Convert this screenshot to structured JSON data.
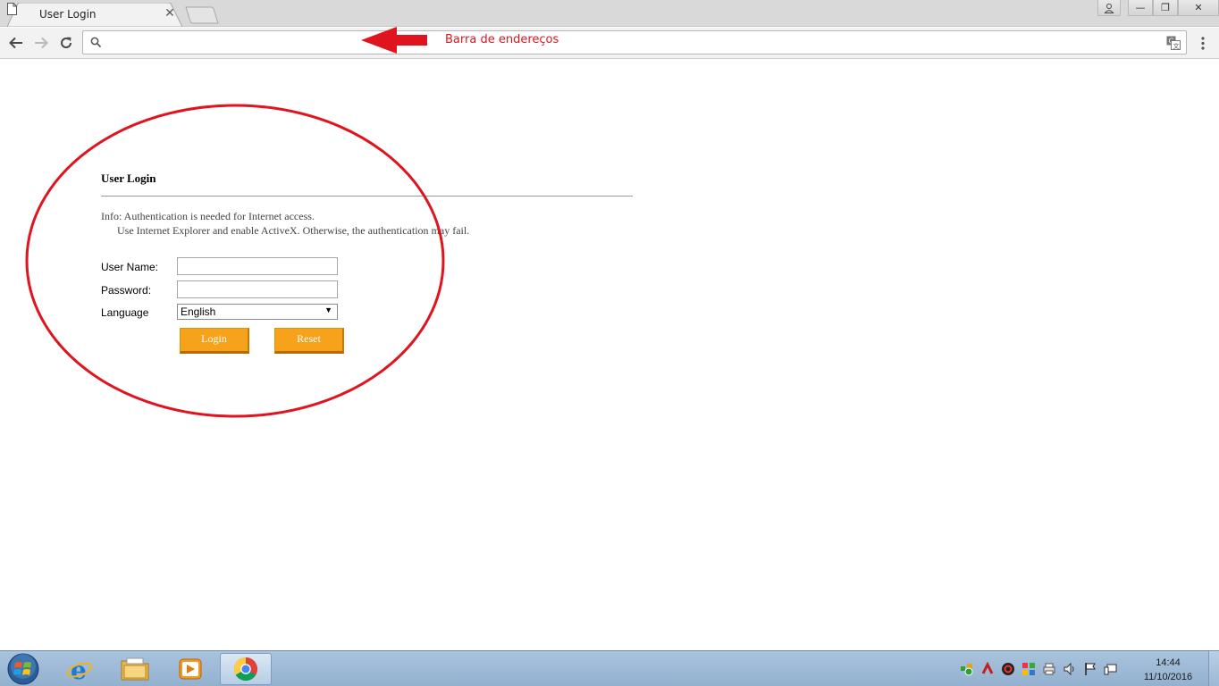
{
  "browser": {
    "tab": {
      "title": "User Login"
    },
    "address_bar": {
      "value": "",
      "placeholder": ""
    },
    "window_buttons": {
      "minimize": "—",
      "restore": "❐",
      "close": "✕"
    }
  },
  "annotation": {
    "label": "Barra de endereços",
    "color": "#e0141e"
  },
  "login": {
    "title": "User Login",
    "info_line1": "Info: Authentication is needed for Internet access.",
    "info_line2": "Use Internet Explorer and enable ActiveX. Otherwise, the authentication may fail.",
    "username_label": "User Name:",
    "username_value": "",
    "password_label": "Password:",
    "password_value": "",
    "language_label": "Language",
    "language_selected": "English",
    "login_button": "Login",
    "reset_button": "Reset",
    "button_color": "#f7a21b"
  },
  "taskbar": {
    "apps": [
      "windows-start",
      "internet-explorer",
      "file-explorer",
      "media-player",
      "google-chrome"
    ],
    "clock_time": "14:44",
    "clock_date": "11/10/2016"
  }
}
